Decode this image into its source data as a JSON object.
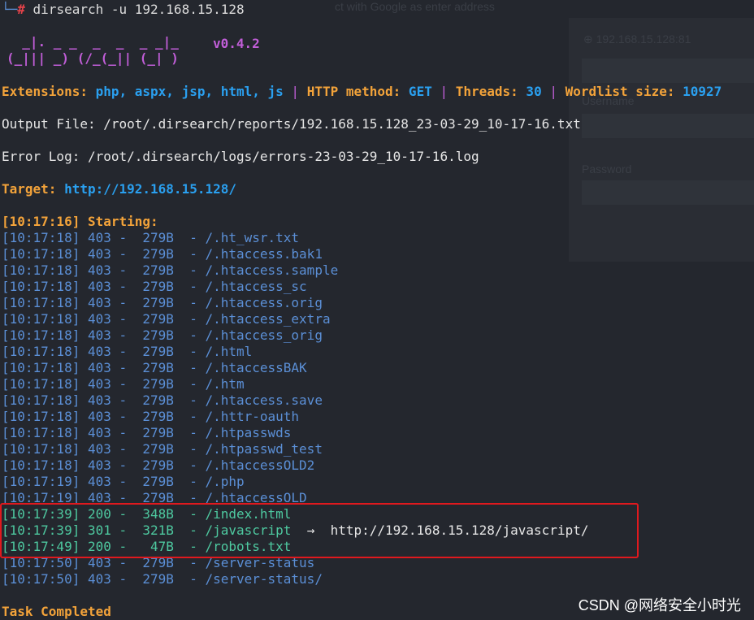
{
  "background_ui": {
    "hint": "ct with Google as enter address",
    "host": "⊕ 192.168.15.128:81",
    "username_label": "Username",
    "password_label": "Password"
  },
  "prompt": {
    "tree": "└─",
    "hash": "#",
    "command": " dirsearch -u 192.168.15.128"
  },
  "banner": {
    "logo_line1": "  _|. _ _  _  _  _ _|_",
    "logo_line2": "(_||| _) (/_(_|| (_| )",
    "version": "v0.4.2"
  },
  "config": {
    "ext_label": "Extensions:",
    "ext_value": " php, aspx, jsp, html, js",
    "sep1": " | ",
    "method_label": "HTTP method:",
    "method_value": " GET",
    "sep2": " | ",
    "threads_label": "Threads:",
    "threads_value": " 30",
    "sep3": " | ",
    "wordlist_label": "Wordlist size:",
    "wordlist_value": " 10927"
  },
  "output_file": "Output File: /root/.dirsearch/reports/192.168.15.128_23-03-29_10-17-16.txt",
  "error_log": "Error Log: /root/.dirsearch/logs/errors-23-03-29_10-17-16.log",
  "target": {
    "label": "Target:",
    "url": " http://192.168.15.128/"
  },
  "starting": "[10:17:16] Starting:",
  "results": [
    {
      "text": "[10:17:18] 403 -  279B  - /.ht_wsr.txt",
      "color": "blue"
    },
    {
      "text": "[10:17:18] 403 -  279B  - /.htaccess.bak1",
      "color": "blue"
    },
    {
      "text": "[10:17:18] 403 -  279B  - /.htaccess.sample",
      "color": "blue"
    },
    {
      "text": "[10:17:18] 403 -  279B  - /.htaccess_sc",
      "color": "blue"
    },
    {
      "text": "[10:17:18] 403 -  279B  - /.htaccess.orig",
      "color": "blue"
    },
    {
      "text": "[10:17:18] 403 -  279B  - /.htaccess_extra",
      "color": "blue"
    },
    {
      "text": "[10:17:18] 403 -  279B  - /.htaccess_orig",
      "color": "blue"
    },
    {
      "text": "[10:17:18] 403 -  279B  - /.html",
      "color": "blue"
    },
    {
      "text": "[10:17:18] 403 -  279B  - /.htaccessBAK",
      "color": "blue"
    },
    {
      "text": "[10:17:18] 403 -  279B  - /.htm",
      "color": "blue"
    },
    {
      "text": "[10:17:18] 403 -  279B  - /.htaccess.save",
      "color": "blue"
    },
    {
      "text": "[10:17:18] 403 -  279B  - /.httr-oauth",
      "color": "blue"
    },
    {
      "text": "[10:17:18] 403 -  279B  - /.htpasswds",
      "color": "blue"
    },
    {
      "text": "[10:17:18] 403 -  279B  - /.htpasswd_test",
      "color": "blue"
    },
    {
      "text": "[10:17:18] 403 -  279B  - /.htaccessOLD2",
      "color": "blue"
    },
    {
      "text": "[10:17:19] 403 -  279B  - /.php",
      "color": "blue"
    },
    {
      "text": "[10:17:19] 403 -  279B  - /.htaccessOLD",
      "color": "blue"
    },
    {
      "text": "[10:17:39] 200 -  348B  - /index.html",
      "color": "green"
    },
    {
      "text": "[10:17:39] 301 -  321B  - /javascript",
      "color": "green",
      "redirect": "  →  http://192.168.15.128/javascript/"
    },
    {
      "text": "[10:17:49] 200 -   47B  - /robots.txt",
      "color": "green"
    },
    {
      "text": "[10:17:50] 403 -  279B  - /server-status",
      "color": "blue"
    },
    {
      "text": "[10:17:50] 403 -  279B  - /server-status/",
      "color": "blue"
    }
  ],
  "completed": "Task Completed",
  "watermark": "CSDN @网络安全小时光",
  "colors": {
    "blue": "#5b8fd6",
    "green": "#4ec9a0",
    "orange": "#f3a33a",
    "cyan": "#2aa0f0",
    "purple": "#c15ed8",
    "highlight": "#e0191e"
  }
}
